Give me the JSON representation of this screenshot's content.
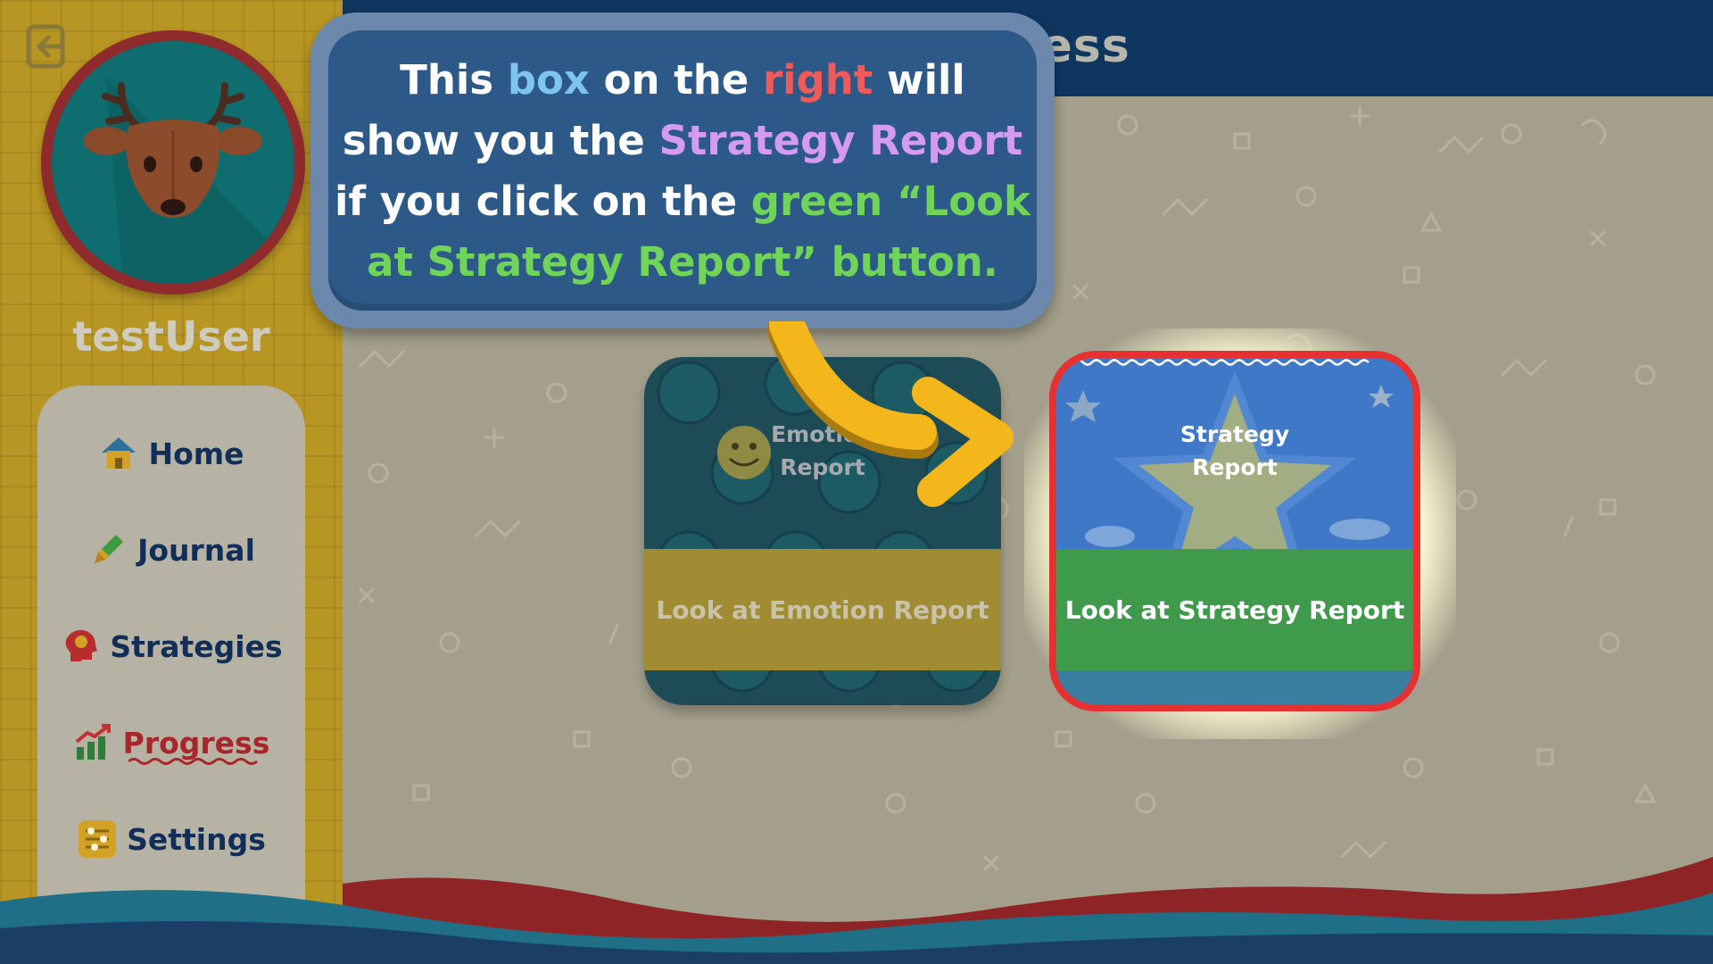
{
  "sidebar": {
    "username": "testUser",
    "nav": [
      {
        "label": "Home",
        "icon": "house-icon"
      },
      {
        "label": "Journal",
        "icon": "pencil-icon"
      },
      {
        "label": "Strategies",
        "icon": "head-icon"
      },
      {
        "label": "Progress",
        "icon": "chart-icon"
      },
      {
        "label": "Settings",
        "icon": "sliders-icon"
      }
    ],
    "active": "Progress"
  },
  "header": {
    "title_visible_fragment": "ress"
  },
  "cards": {
    "emotion": {
      "title_line1": "Emotion",
      "title_line2": "Report",
      "button": "Look at Emotion Report"
    },
    "strategy": {
      "title_line1": "Strategy",
      "title_line2": "Report",
      "button": "Look at Strategy Report"
    }
  },
  "tutorial": {
    "segments": [
      "This ",
      "box",
      " on the ",
      "right",
      " will",
      "show you the ",
      "Strategy Report",
      "if you click on the ",
      "green “Look",
      "at Strategy Report” button."
    ]
  },
  "colors": {
    "topbar": "#0e365f",
    "sidebar": "#b89623",
    "highlight_frame": "#e63133",
    "tutorial_box": "#2c5987",
    "accent_blue": "#7ec4ef",
    "accent_red": "#f15a5a",
    "accent_purple": "#d59bf2",
    "accent_green": "#6fd457",
    "arrow": "#f3b61b"
  }
}
